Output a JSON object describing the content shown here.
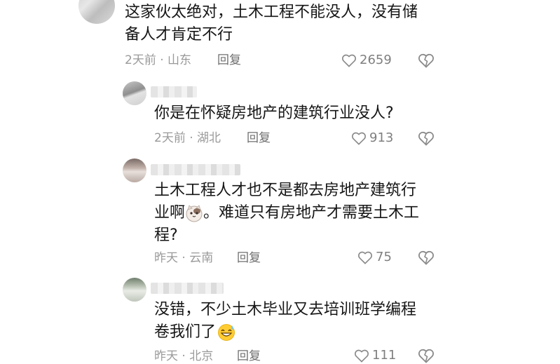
{
  "comments": [
    {
      "text_line1": "这家伙太绝对，土木工程不能没人，没有储",
      "text_line2": "备人才肯定不行",
      "time_location": "2天前 · 山东",
      "reply_label": "回复",
      "likes": "2659"
    },
    {
      "text_line1": "你是在怀疑房地产的建筑行业没人?",
      "time_location": "2天前 · 湖北",
      "reply_label": "回复",
      "likes": "913"
    },
    {
      "text_line1": "土木工程人才也不是都去房地产建筑行",
      "text_line2_a": "业啊",
      "text_line2_b": "。难道只有房地产才需要土木工",
      "text_line3": "程?",
      "time_location": "昨天 · 云南",
      "reply_label": "回复",
      "likes": "75"
    },
    {
      "text_line1": "没错，不少土木毕业又去培训班学编程",
      "text_line2": "卷我们了",
      "time_location": "昨天 · 北京",
      "reply_label": "回复",
      "likes": "111"
    }
  ]
}
